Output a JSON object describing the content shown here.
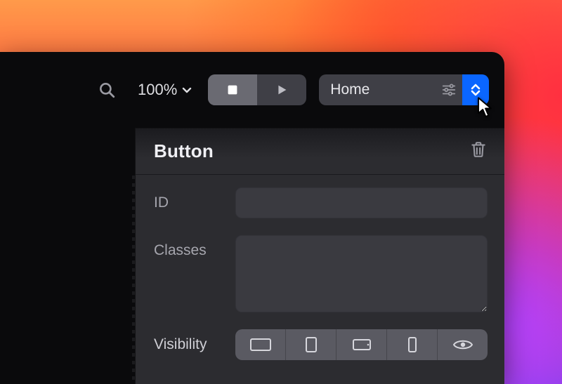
{
  "toolbar": {
    "zoom": "100%",
    "page_selected": "Home"
  },
  "panel": {
    "title": "Button",
    "fields": {
      "id_label": "ID",
      "id_value": "",
      "classes_label": "Classes",
      "classes_value": "",
      "visibility_label": "Visibility"
    }
  },
  "colors": {
    "accent_blue": "#0a66ff"
  }
}
